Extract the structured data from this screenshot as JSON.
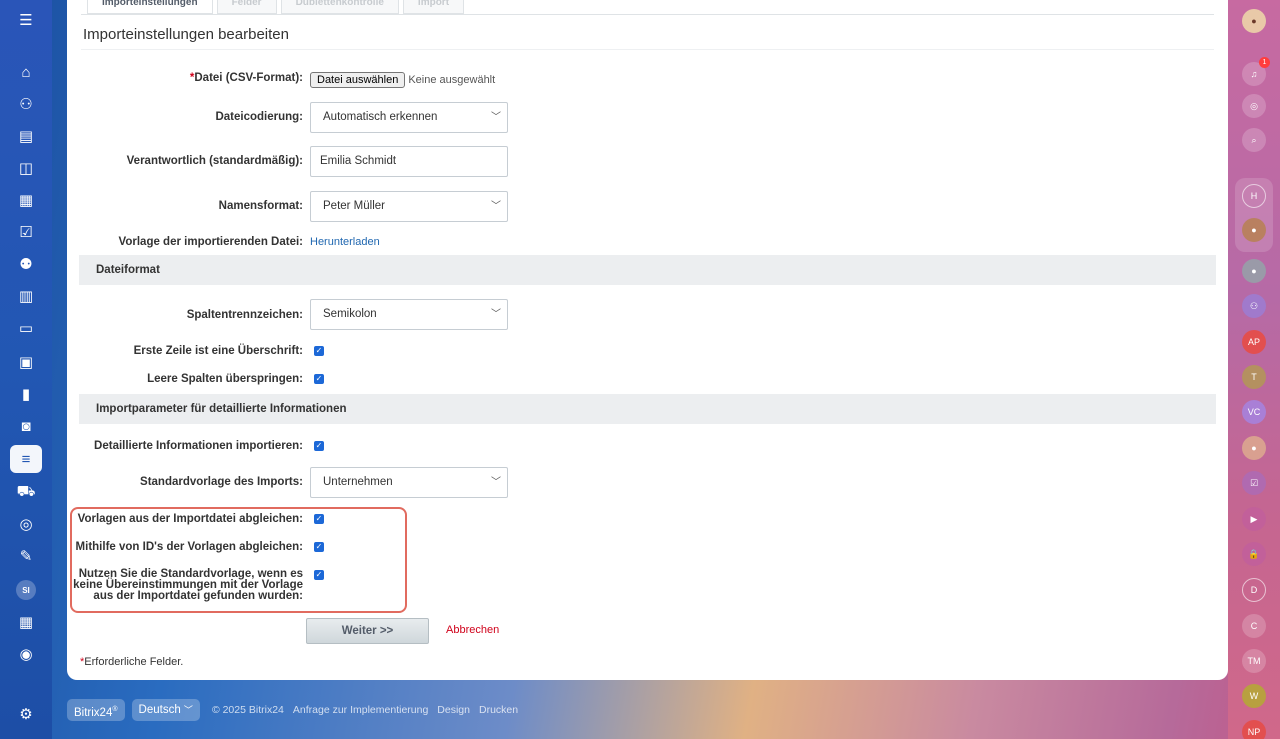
{
  "tabs": [
    "Importeinstellungen",
    "Felder",
    "Dublettenkontrolle",
    "Import"
  ],
  "page_title": "Importeinstellungen bearbeiten",
  "fields": {
    "file_label": "Datei (CSV-Format):",
    "file_button": "Datei auswählen",
    "file_status": "Keine ausgewählt",
    "encoding_label": "Dateicodierung:",
    "encoding_value": "Automatisch erkennen",
    "responsible_label": "Verantwortlich (standardmäßig):",
    "responsible_value": "Emilia Schmidt",
    "nameformat_label": "Namensformat:",
    "nameformat_value": "Peter Müller",
    "template_label": "Vorlage der importierenden Datei:",
    "template_link": "Herunterladen"
  },
  "section_fileformat": "Dateiformat",
  "fileformat": {
    "separator_label": "Spaltentrennzeichen:",
    "separator_value": "Semikolon",
    "header_label": "Erste Zeile ist eine Überschrift:",
    "skip_label": "Leere Spalten überspringen:"
  },
  "section_details": "Importparameter für detaillierte Informationen",
  "details": {
    "import_details_label": "Detaillierte Informationen importieren:",
    "default_template_label": "Standardvorlage des Imports:",
    "default_template_value": "Unternehmen",
    "match_templates_label": "Vorlagen aus der Importdatei abgleichen:",
    "match_ids_label": "Mithilfe von ID's der Vorlagen abgleichen:",
    "use_default_line1": "Nutzen Sie die Standardvorlage, wenn es",
    "use_default_line2": "keine Übereinstimmungen mit der Vorlage",
    "use_default_line3": "aus der Importdatei gefunden wurden:"
  },
  "actions": {
    "next": "Weiter >>",
    "cancel": "Abbrechen"
  },
  "required_mark": "*",
  "required_note": "Erforderliche Felder.",
  "footer": {
    "brand": "Bitrix24",
    "brand_sup": "®",
    "language": "Deutsch",
    "copyright": "© 2025 Bitrix24",
    "links": [
      "Anfrage zur Implementierung",
      "Design",
      "Drucken"
    ]
  },
  "right_avatars": [
    "H",
    "AP",
    "T",
    "VC",
    "D",
    "C",
    "TM",
    "W",
    "NP"
  ],
  "notification_count": "1",
  "left_avatar": "SI",
  "colors": {
    "accent": "#1c68d7",
    "link": "#2067b0",
    "cancel": "#d0021b",
    "highlight": "#e16b5f"
  }
}
